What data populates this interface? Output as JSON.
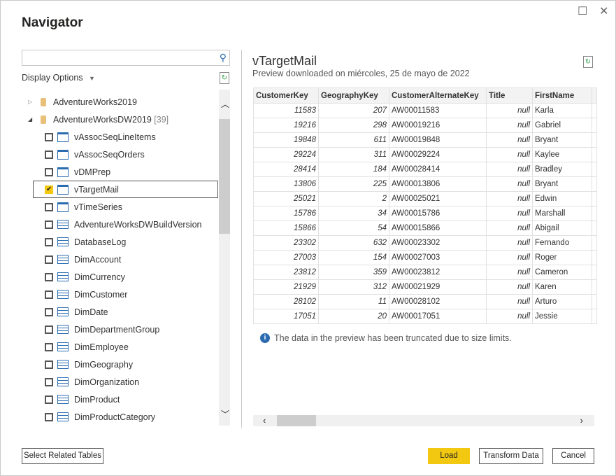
{
  "window": {
    "title": "Navigator"
  },
  "left": {
    "search_placeholder": "",
    "display_options": "Display Options",
    "servers": [
      {
        "label": "AdventureWorks2019",
        "count": ""
      },
      {
        "label": "AdventureWorksDW2019",
        "count": "[39]"
      }
    ],
    "items": [
      {
        "label": "vAssocSeqLineItems",
        "type": "view",
        "checked": false
      },
      {
        "label": "vAssocSeqOrders",
        "type": "view",
        "checked": false
      },
      {
        "label": "vDMPrep",
        "type": "view",
        "checked": false
      },
      {
        "label": "vTargetMail",
        "type": "view",
        "checked": true
      },
      {
        "label": "vTimeSeries",
        "type": "view",
        "checked": false
      },
      {
        "label": "AdventureWorksDWBuildVersion",
        "type": "table",
        "checked": false
      },
      {
        "label": "DatabaseLog",
        "type": "table",
        "checked": false
      },
      {
        "label": "DimAccount",
        "type": "table",
        "checked": false
      },
      {
        "label": "DimCurrency",
        "type": "table",
        "checked": false
      },
      {
        "label": "DimCustomer",
        "type": "table",
        "checked": false
      },
      {
        "label": "DimDate",
        "type": "table",
        "checked": false
      },
      {
        "label": "DimDepartmentGroup",
        "type": "table",
        "checked": false
      },
      {
        "label": "DimEmployee",
        "type": "table",
        "checked": false
      },
      {
        "label": "DimGeography",
        "type": "table",
        "checked": false
      },
      {
        "label": "DimOrganization",
        "type": "table",
        "checked": false
      },
      {
        "label": "DimProduct",
        "type": "table",
        "checked": false
      },
      {
        "label": "DimProductCategory",
        "type": "table",
        "checked": false
      }
    ]
  },
  "preview": {
    "title": "vTargetMail",
    "subtitle": "Preview downloaded on miércoles, 25 de mayo de 2022",
    "columns": [
      "CustomerKey",
      "GeographyKey",
      "CustomerAlternateKey",
      "Title",
      "FirstName"
    ],
    "rows": [
      [
        "11583",
        "207",
        "AW00011583",
        "null",
        "Karla"
      ],
      [
        "19216",
        "298",
        "AW00019216",
        "null",
        "Gabriel"
      ],
      [
        "19848",
        "611",
        "AW00019848",
        "null",
        "Bryant"
      ],
      [
        "29224",
        "311",
        "AW00029224",
        "null",
        "Kaylee"
      ],
      [
        "28414",
        "184",
        "AW00028414",
        "null",
        "Bradley"
      ],
      [
        "13806",
        "225",
        "AW00013806",
        "null",
        "Bryant"
      ],
      [
        "25021",
        "2",
        "AW00025021",
        "null",
        "Edwin"
      ],
      [
        "15786",
        "34",
        "AW00015786",
        "null",
        "Marshall"
      ],
      [
        "15866",
        "54",
        "AW00015866",
        "null",
        "Abigail"
      ],
      [
        "23302",
        "632",
        "AW00023302",
        "null",
        "Fernando"
      ],
      [
        "27003",
        "154",
        "AW00027003",
        "null",
        "Roger"
      ],
      [
        "23812",
        "359",
        "AW00023812",
        "null",
        "Cameron"
      ],
      [
        "21929",
        "312",
        "AW00021929",
        "null",
        "Karen"
      ],
      [
        "28102",
        "11",
        "AW00028102",
        "null",
        "Arturo"
      ],
      [
        "17051",
        "20",
        "AW00017051",
        "null",
        "Jessie"
      ]
    ],
    "truncated_note": "The data in the preview has been truncated due to size limits."
  },
  "buttons": {
    "select_related": "Select Related Tables",
    "load": "Load",
    "transform": "Transform Data",
    "cancel": "Cancel"
  },
  "colors": {
    "accent": "#F2C811",
    "icon_blue": "#2B6CB0"
  }
}
